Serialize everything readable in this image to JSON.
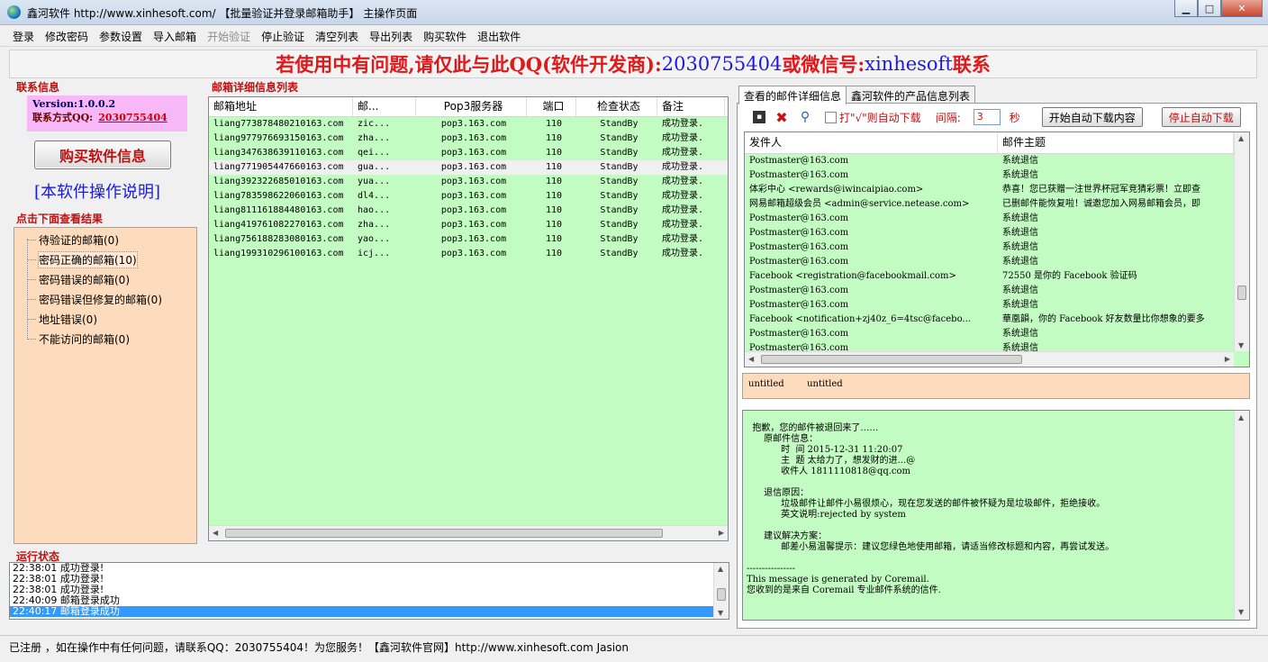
{
  "window": {
    "title": "鑫河软件 http://www.xinhesoft.com/ 【批量验证并登录邮箱助手】 主操作页面"
  },
  "menu": [
    {
      "label": "登录",
      "disabled": false
    },
    {
      "label": "修改密码",
      "disabled": false
    },
    {
      "label": "参数设置",
      "disabled": false
    },
    {
      "label": "导入邮箱",
      "disabled": false
    },
    {
      "label": "开始验证",
      "disabled": true
    },
    {
      "label": "停止验证",
      "disabled": false
    },
    {
      "label": "清空列表",
      "disabled": false
    },
    {
      "label": "导出列表",
      "disabled": false
    },
    {
      "label": "购买软件",
      "disabled": false
    },
    {
      "label": "退出软件",
      "disabled": false
    }
  ],
  "banner": {
    "text": "若使用中有问题,请仅此与此QQ(软件开发商):",
    "qq": "2030755404",
    "mid": "或微信号:",
    "wechat": "xinhesoft",
    "tail": "联系"
  },
  "contact": {
    "title": "联系信息",
    "version": "Version:1.0.0.2",
    "qq_label": "联系方式QQ:",
    "qq": "2030755404",
    "buy_button": "购买软件信息",
    "help_link": "[本软件操作说明]"
  },
  "results": {
    "title": "点击下面查看结果",
    "items": [
      "待验证的邮箱(0)",
      "密码正确的邮箱(10)",
      "密码错误的邮箱(0)",
      "密码错误但修复的邮箱(0)",
      "地址错误(0)",
      "不能访问的邮箱(0)"
    ]
  },
  "mailbox_list": {
    "title": "邮箱详细信息列表",
    "columns": [
      "邮箱地址",
      "邮...",
      "Pop3服务器",
      "端口",
      "检查状态",
      "备注"
    ],
    "rows": [
      [
        "liang773878480210163.com",
        "zic...",
        "pop3.163.com",
        "110",
        "StandBy",
        "成功登录."
      ],
      [
        "liang977976693150163.com",
        "zha...",
        "pop3.163.com",
        "110",
        "StandBy",
        "成功登录."
      ],
      [
        "liang347638639110163.com",
        "qei...",
        "pop3.163.com",
        "110",
        "StandBy",
        "成功登录."
      ],
      [
        "liang771905447660163.com",
        "gua...",
        "pop3.163.com",
        "110",
        "StandBy",
        "成功登录."
      ],
      [
        "liang392322685010163.com",
        "yua...",
        "pop3.163.com",
        "110",
        "StandBy",
        "成功登录."
      ],
      [
        "liang783598622060163.com",
        "dl4...",
        "pop3.163.com",
        "110",
        "StandBy",
        "成功登录."
      ],
      [
        "liang811161884480163.com",
        "hao...",
        "pop3.163.com",
        "110",
        "StandBy",
        "成功登录."
      ],
      [
        "liang419761082270163.com",
        "zha...",
        "pop3.163.com",
        "110",
        "StandBy",
        "成功登录."
      ],
      [
        "liang756188283080163.com",
        "yao...",
        "pop3.163.com",
        "110",
        "StandBy",
        "成功登录."
      ],
      [
        "liang199310296100163.com",
        "icj...",
        "pop3.163.com",
        "110",
        "StandBy",
        "成功登录."
      ]
    ]
  },
  "tabs": [
    "查看的邮件详细信息",
    "鑫河软件的产品信息列表"
  ],
  "toolbar": {
    "checkbox_label": "打\"√\"则自动下载",
    "interval_label": "间隔:",
    "interval_value": "3",
    "seconds": "秒",
    "start_button": "开始自动下载内容",
    "stop_button": "停止自动下载"
  },
  "mail_list": {
    "columns": [
      "发件人",
      "邮件主题"
    ],
    "rows": [
      [
        "Postmaster@163.com",
        "系统退信"
      ],
      [
        "Postmaster@163.com",
        "系统退信"
      ],
      [
        "体彩中心 <rewards@iwincaipiao.com>",
        "恭喜！您已获赠一注世界杯冠军竞猜彩票！立即查"
      ],
      [
        "网易邮箱超级会员 <admin@service.netease.com>",
        "已删邮件能恢复啦！诚邀您加入网易邮箱会员，即"
      ],
      [
        "Postmaster@163.com",
        "系统退信"
      ],
      [
        "Postmaster@163.com",
        "系统退信"
      ],
      [
        "Postmaster@163.com",
        "系统退信"
      ],
      [
        "Postmaster@163.com",
        "系统退信"
      ],
      [
        "Facebook <registration@facebookmail.com>",
        "72550 是你的 Facebook 验证码"
      ],
      [
        "Postmaster@163.com",
        "系统退信"
      ],
      [
        "Postmaster@163.com",
        "系统退信"
      ],
      [
        "Facebook <notification+zj40z_6=4tsc@facebo...",
        "華凰韻，你的 Facebook 好友数量比你想象的要多"
      ],
      [
        "Postmaster@163.com",
        "系统退信"
      ],
      [
        "Postmaster@163.com",
        "系统退信"
      ]
    ]
  },
  "untitled_line": "untitled        untitled",
  "mail_body": "抱歉，您的邮件被退回来了……\n      原邮件信息：\n            时  间 2015-12-31 11:20:07\n            主  题 太给力了，想发财的进...@\n            收件人 1811110818@qq.com\n\n      退信原因：\n            垃圾邮件让邮件小易很烦心，现在您发送的邮件被怀疑为是垃圾邮件，拒绝接收。\n            英文说明:rejected by system\n\n      建议解决方案：\n            邮差小易温馨提示：建议您绿色地使用邮箱，请适当修改标题和内容，再尝试发送。\n\n----------------\nThis message is generated by Coremail.\n您收到的是来自 Coremail 专业邮件系统的信件.",
  "run_status": {
    "title": "运行状态",
    "lines": [
      "22:38:01 成功登录!",
      "22:38:01 成功登录!",
      "22:38:01 成功登录!",
      "22:40:09 邮箱登录成功",
      "22:40:17 邮箱登录成功"
    ]
  },
  "statusbar": "已注册 ，如在操作中有任何问题，请联系QQ：2030755404！为您服务！【鑫河软件官网】http://www.xinhesoft.com    Jasion"
}
